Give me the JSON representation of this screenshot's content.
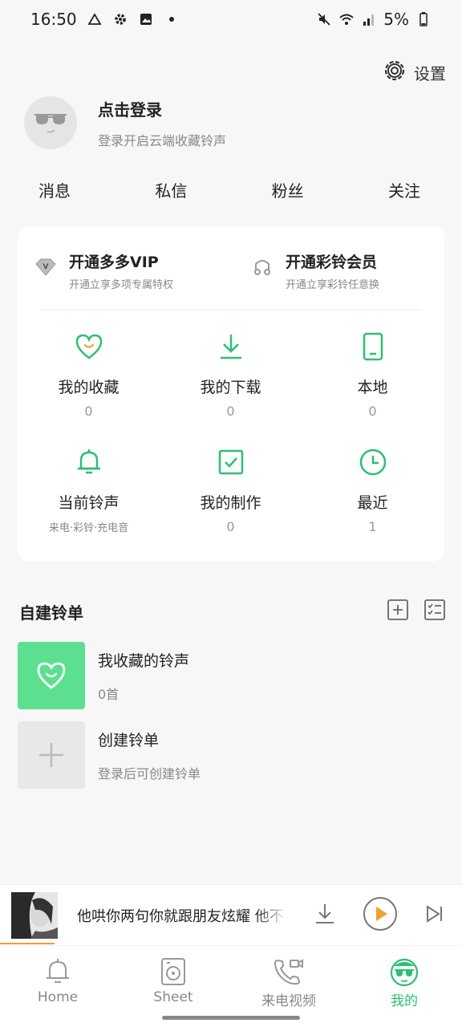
{
  "status": {
    "time": "16:50",
    "battery": "5%"
  },
  "header": {
    "settings_label": "设置"
  },
  "profile": {
    "title": "点击登录",
    "subtitle": "登录开启云端收藏铃声"
  },
  "social": [
    "消息",
    "私信",
    "粉丝",
    "关注"
  ],
  "vip": [
    {
      "title": "开通多多VIP",
      "subtitle": "开通立享多项专属特权",
      "icon": "diamond-icon"
    },
    {
      "title": "开通彩铃会员",
      "subtitle": "开通立享彩铃任意换",
      "icon": "music-note-icon"
    }
  ],
  "grid": [
    {
      "label": "我的收藏",
      "count": "0",
      "icon": "heart-icon"
    },
    {
      "label": "我的下载",
      "count": "0",
      "icon": "download-icon"
    },
    {
      "label": "本地",
      "count": "0",
      "icon": "phone-icon"
    },
    {
      "label": "当前铃声",
      "sub": "来电·彩铃·充电音",
      "icon": "bell-icon"
    },
    {
      "label": "我的制作",
      "count": "0",
      "icon": "checkbox-icon"
    },
    {
      "label": "最近",
      "count": "1",
      "icon": "clock-icon"
    }
  ],
  "playlists": {
    "title": "自建铃单",
    "items": [
      {
        "name": "我收藏的铃声",
        "meta": "0首"
      },
      {
        "name": "创建铃单",
        "meta": "登录后可创建铃单"
      }
    ]
  },
  "player": {
    "title": "他哄你两句你就跟朋友炫耀 他不",
    "progress": 0.12
  },
  "tabs": [
    {
      "label": "Home",
      "icon": "bell-icon"
    },
    {
      "label": "Sheet",
      "icon": "disc-icon"
    },
    {
      "label": "来电视频",
      "icon": "phone-video-icon"
    },
    {
      "label": "我的",
      "icon": "profile-icon"
    }
  ],
  "colors": {
    "accent": "#2dbf72",
    "player_accent": "#f0a030",
    "fav_tile": "#5ddf90"
  }
}
